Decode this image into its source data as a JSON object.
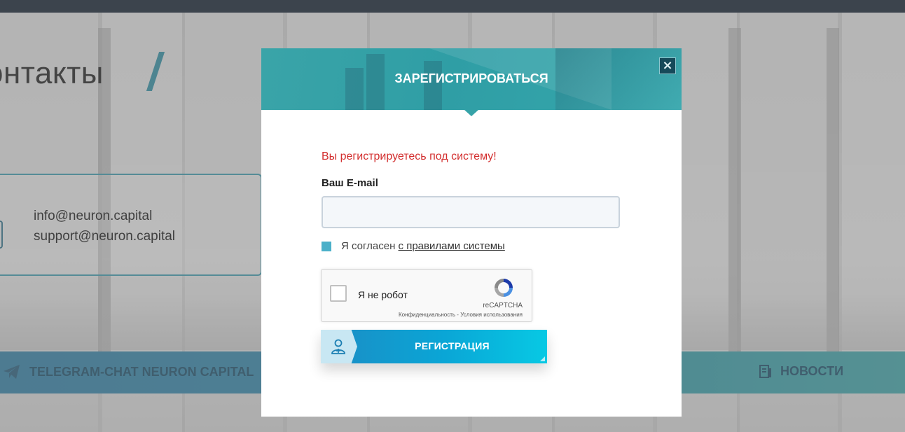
{
  "background": {
    "heading": "онтакты",
    "contacts": [
      "info@neuron.capital",
      "support@neuron.capital"
    ],
    "bottom_links": {
      "telegram": "TELEGRAM-CHAT NEURON CAPITAL",
      "news": "НОВОСТИ"
    }
  },
  "modal": {
    "title": "ЗАРЕГИСТРИРОВАТЬСЯ",
    "close_label": "×",
    "notice": "Вы регистрируетесь под систему!",
    "email_label": "Ваш E-mail",
    "email_value": "",
    "agree_text": "Я согласен",
    "agree_link": "с правилами системы",
    "recaptcha": {
      "label": "Я не робот",
      "brand": "reCAPTCHA",
      "links": "Конфиденциальность - Условия использования"
    },
    "register_button": "РЕГИСТРАЦИЯ"
  },
  "colors": {
    "header_teal": "#2f9ea5",
    "notice_red": "#d32f2f",
    "button_blue": "#0aa6d6",
    "checkbox_blue": "#4bb0c9"
  }
}
